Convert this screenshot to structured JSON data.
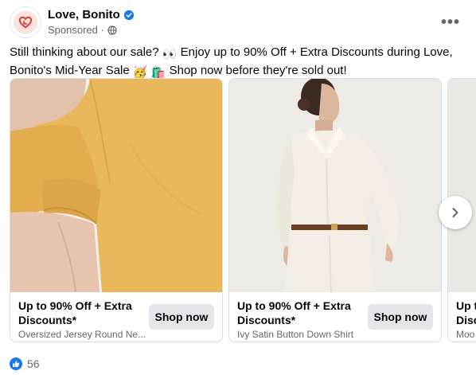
{
  "post": {
    "page_name": "Love, Bonito",
    "sponsored_label": "Sponsored ·",
    "text_part1": "Still thinking about our sale? ",
    "text_part2": " Enjoy up to 90% Off + Extra Discounts during Love, Bonito's Mid-Year Sale ",
    "text_part3": " Shop now  before they're sold out!",
    "emoji1": "👀",
    "emoji2": "🥳",
    "emoji3": "🛍️"
  },
  "cards": [
    {
      "title": "Up to 90% Off + Extra Discounts*",
      "description": "Oversized Jersey Round Ne...",
      "cta": "Shop now"
    },
    {
      "title": "Up to 90% Off + Extra Discounts*",
      "description": "Ivy Satin Button Down Shirt",
      "cta": "Shop now"
    },
    {
      "title": "Up t",
      "title2": "Disc",
      "description": "Moo"
    }
  ],
  "reactions": {
    "count": "56",
    "icon": "like-icon"
  },
  "colors": {
    "brand_blue": "#1877f2",
    "button_gray": "#e4e6eb",
    "muted_text": "#65676b",
    "shirt_yellow": "#e8b85a",
    "blouse_white": "#f1ede4"
  }
}
